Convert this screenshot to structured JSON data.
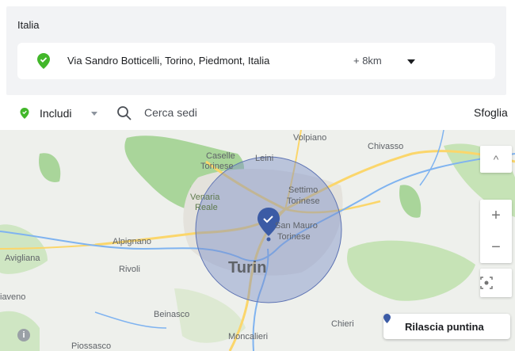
{
  "location": {
    "country": "Italia",
    "address": "Via Sandro Botticelli, Torino, Piedmont, Italia",
    "radius": "+ 8km"
  },
  "toolbar": {
    "include_label": "Includi",
    "search_placeholder": "Cerca sedi",
    "browse_label": "Sfoglia"
  },
  "map": {
    "labels": {
      "volpiano": "Volpiano",
      "chivasso": "Chivasso",
      "caselle": "Caselle",
      "torinese": "Torinese",
      "leini": "Leini",
      "venaria": "Venaria",
      "reale": "Reale",
      "settimo": "Settimo",
      "settimo_torinese": "Torinese",
      "alpignano": "Alpignano",
      "san_mauro": "San Mauro",
      "san_mauro_torinese": "Torinese",
      "avigliana": "Avigliana",
      "rivoli": "Rivoli",
      "turin": "Turin",
      "giaveno": "iaveno",
      "beinasco": "Beinasco",
      "chieri": "Chieri",
      "moncalieri": "Moncalieri",
      "piossasco": "Piossasco"
    },
    "zoom_in": "+",
    "zoom_out": "−",
    "drop_pin_label": "Rilascia puntina",
    "info_glyph": "i"
  },
  "colors": {
    "pin_green": "#42b72a",
    "marker_blue": "#3b5ba5",
    "radius_fill": "#7b8fc7",
    "water": "#7fb3f0",
    "highway": "#fbd66b",
    "park": "#a9d59a"
  },
  "icons": {
    "location_pin": "location-pin-icon",
    "search": "search-icon",
    "map_marker": "map-marker-icon",
    "recenter": "recenter-icon",
    "info": "info-icon"
  }
}
